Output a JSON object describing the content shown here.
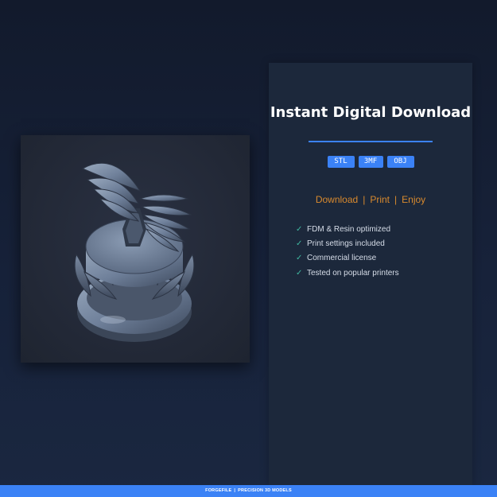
{
  "listing": {
    "title": "Instant Digital Download",
    "formats": [
      "STL",
      "3MF",
      "OBJ"
    ],
    "tagline": {
      "items": [
        "Download",
        "Print",
        "Enjoy"
      ],
      "separator": "|"
    },
    "features": [
      "FDM & Resin optimized",
      "Print settings included",
      "Commercial license",
      "Tested on popular printers"
    ],
    "check_glyph": "✓"
  },
  "footer": {
    "brand": "FORGEFILE",
    "separator": "|",
    "slogan": "PRECISION 3D MODELS"
  },
  "preview": {
    "icon": "winged-helmet-model"
  },
  "colors": {
    "accent": "#3b82f6",
    "tagline": "#d98a2e",
    "check": "#3fb8a0",
    "panel": "#1c283b",
    "background": "#121a2c"
  }
}
